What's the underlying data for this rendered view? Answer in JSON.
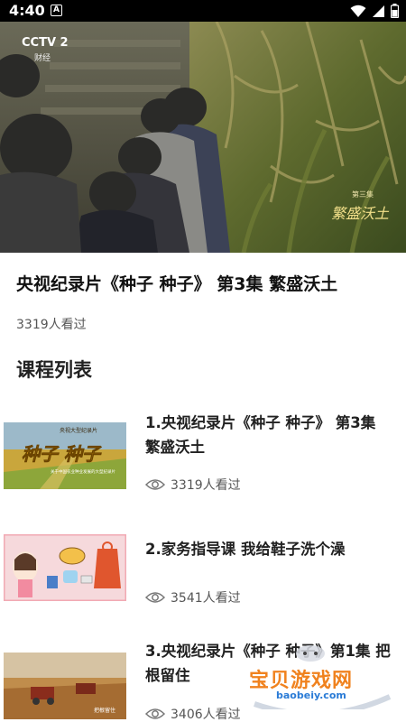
{
  "status_bar": {
    "time": "4:40",
    "sim_badge": "A"
  },
  "video": {
    "channel_logo": "CCTV 2",
    "channel_sub": "财经",
    "overlay_caption_small": "第三集",
    "overlay_caption": "繁盛沃土"
  },
  "main": {
    "title": "央视纪录片《种子 种子》 第3集 繁盛沃土",
    "views": "3319人看过",
    "section_title": "课程列表"
  },
  "courses": [
    {
      "title": "1.央视纪录片《种子 种子》 第3集 繁盛沃土",
      "views": "3319人看过",
      "thumb_top_text": "央视大型纪录片",
      "thumb_big_text": "种子 种子",
      "thumb_sub_text": "关于中国农业种业发展的大型纪录片"
    },
    {
      "title": "2.家务指导课 我给鞋子洗个澡",
      "views": "3541人看过"
    },
    {
      "title": "3.央视纪录片《种子 种子》第1集 把根留住",
      "views": "3406人看过",
      "thumb_caption": "把根留住"
    }
  ],
  "watermark": {
    "text": "宝贝游戏网",
    "url": "baobeiy.com"
  },
  "icons": [
    "eye-icon",
    "wifi-icon",
    "signal-icon",
    "battery-icon"
  ],
  "colors": {
    "accent_orange": "#f0821e",
    "watermark_blue": "#2a7bd6"
  }
}
